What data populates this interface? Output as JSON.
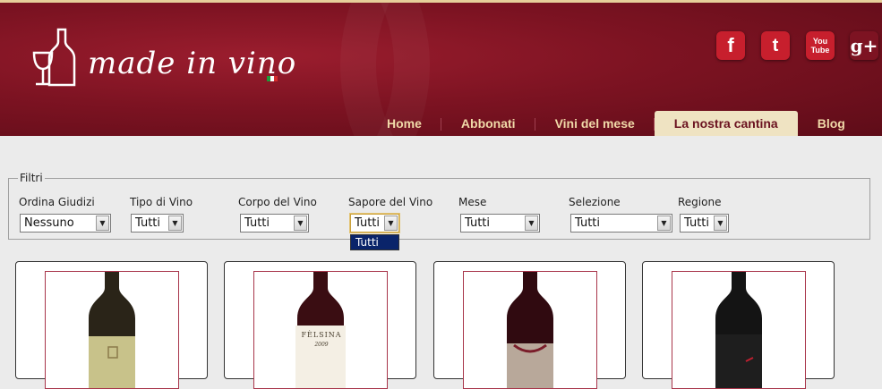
{
  "brand": {
    "logo_text": "made in vino"
  },
  "social": [
    {
      "icon": "facebook-icon",
      "glyph": "f",
      "color": "#c71f2d"
    },
    {
      "icon": "twitter-icon",
      "glyph": "t",
      "color": "#c71f2d"
    },
    {
      "icon": "youtube-icon",
      "glyph": "You Tube",
      "color": "#c71f2d"
    },
    {
      "icon": "google-plus-icon",
      "glyph": "g+",
      "color": "#7d1322"
    }
  ],
  "nav": {
    "items": [
      {
        "label": "Home"
      },
      {
        "label": "Abbonati"
      },
      {
        "label": "Vini del mese"
      },
      {
        "label": "La nostra cantina",
        "active": true
      },
      {
        "label": "Blog"
      }
    ]
  },
  "filters": {
    "legend": "Filtri",
    "fields": [
      {
        "label": "Ordina Giudizi",
        "value": "Nessuno"
      },
      {
        "label": "Tipo di Vino",
        "value": "Tutti"
      },
      {
        "label": "Corpo del Vino",
        "value": "Tutti"
      },
      {
        "label": "Sapore del Vino",
        "value": "Tutti"
      },
      {
        "label": "Mese",
        "value": "Tutti"
      },
      {
        "label": "Selezione",
        "value": "Tutti"
      },
      {
        "label": "Regione",
        "value": "Tutti"
      }
    ],
    "open_dropdown_option": "Tutti"
  },
  "products": [
    {
      "label_text": "",
      "bottle_color": "#2a2418",
      "label_color": "#c8c28a"
    },
    {
      "label_text": "FÈLSINA",
      "vintage": "2009",
      "bottle_color": "#3a0d12",
      "label_color": "#f4efe4"
    },
    {
      "label_text": "",
      "bottle_color": "#300a10",
      "label_color": "#b8a89a"
    },
    {
      "label_text": "",
      "bottle_color": "#141414",
      "label_color": "#1e1e1e"
    }
  ]
}
